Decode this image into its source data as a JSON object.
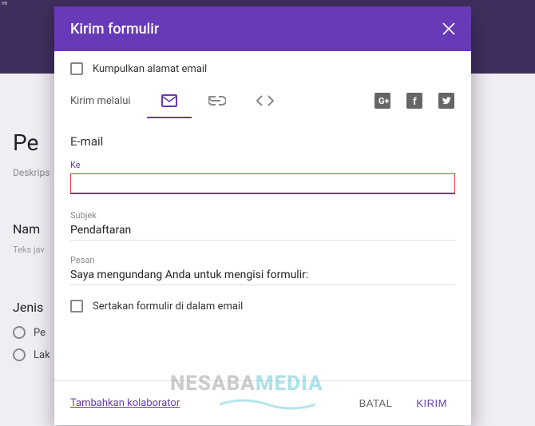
{
  "bg": {
    "topbar": "ve",
    "title": "Pe",
    "desc": "Deskrips",
    "q1": "Nam",
    "hint": "Teks jav",
    "q2": "Jenis",
    "r1": "Pe",
    "r2": "Lak"
  },
  "modal": {
    "title": "Kirim formulir",
    "collectEmails": "Kumpulkan alamat email",
    "sendViaLabel": "Kirim melalui",
    "emailSection": "E-mail",
    "toLabel": "Ke",
    "toValue": "",
    "subjectLabel": "Subjek",
    "subjectValue": "Pendaftaran",
    "messageLabel": "Pesan",
    "messageValue": "Saya mengundang Anda untuk mengisi formulir:",
    "includeForm": "Sertakan formulir di dalam email",
    "addCollaborators": "Tambahkan kolaborator",
    "cancel": "BATAL",
    "send": "KIRIM"
  },
  "watermark": {
    "part1": "NESABA",
    "part2": "MEDIA"
  }
}
